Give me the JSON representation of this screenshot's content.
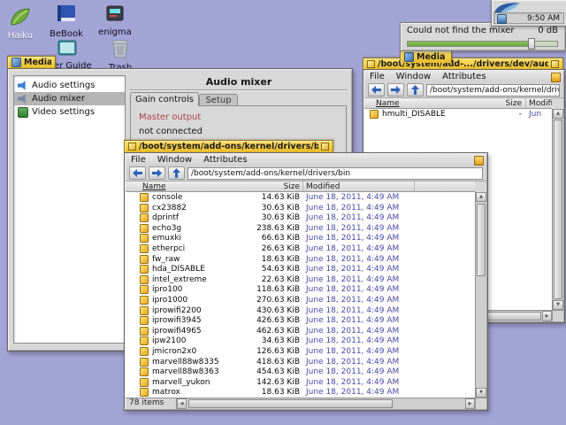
{
  "colors": {
    "desktop": "#a2a4d6",
    "window-bg": "#d8d8d8",
    "tab-top": "#fce06a",
    "tab-bottom": "#e9bb28",
    "tab-border": "#8f7215",
    "selection": "#b4b4b4",
    "date-text": "#4a4aa8",
    "master-output": "#aa4444",
    "nav-arrow": "#2e62b8",
    "slider-green": "#6da443"
  },
  "desktop": {
    "icons": [
      {
        "label": "Haiku",
        "icon": "haiku-leaf"
      },
      {
        "label": "BeBook",
        "icon": "bebook"
      },
      {
        "label": "enigma",
        "icon": "enigma"
      },
      {
        "label": "User Guide",
        "icon": "user-guide"
      },
      {
        "label": "Trash",
        "icon": "trash"
      }
    ]
  },
  "deskbar": {
    "time": "9:50 AM"
  },
  "notification": {
    "message": "Could not find the mixer",
    "value": "0 dB",
    "slider_percent": 82
  },
  "media_mini_tab": {
    "title": "Media"
  },
  "media_window": {
    "tab_title": "Media",
    "panel_title": "Audio mixer",
    "list": [
      {
        "label": "Audio settings",
        "icon": "audio-settings"
      },
      {
        "label": "Audio mixer",
        "icon": "audio-mixer",
        "selected": true
      },
      {
        "label": "Video settings",
        "icon": "video-settings"
      }
    ],
    "tabs": [
      {
        "label": "Gain controls",
        "active": true
      },
      {
        "label": "Setup",
        "active": false
      }
    ],
    "content": {
      "line1": "Master output",
      "line2": "not connected"
    }
  },
  "audio_window": {
    "tab_title": "/boot/system/add-.../drivers/dev/audio",
    "menus": [
      "File",
      "Window",
      "Attributes"
    ],
    "path": "/boot/system/add-ons/kernel/drivers/dev/audio",
    "columns": [
      "Name",
      "Size",
      "Modified"
    ],
    "rows": [
      {
        "name": "hmulti_DISABLE",
        "size": "-",
        "modified": "Jun"
      }
    ]
  },
  "bin_window": {
    "tab_title": "/boot/system/add-ons/kernel/drivers/bin",
    "menus": [
      "File",
      "Window",
      "Attributes"
    ],
    "path": "/boot/system/add-ons/kernel/drivers/bin",
    "columns": [
      "Name",
      "Size",
      "Modified"
    ],
    "status": "78 items",
    "rows": [
      {
        "name": "console",
        "size": "14.63 KiB",
        "modified": "June 18, 2011, 4:49 AM"
      },
      {
        "name": "cx23882",
        "size": "30.63 KiB",
        "modified": "June 18, 2011, 4:49 AM"
      },
      {
        "name": "dprintf",
        "size": "30.63 KiB",
        "modified": "June 18, 2011, 4:49 AM"
      },
      {
        "name": "echo3g",
        "size": "238.63 KiB",
        "modified": "June 18, 2011, 4:49 AM"
      },
      {
        "name": "emuxki",
        "size": "66.63 KiB",
        "modified": "June 18, 2011, 4:49 AM"
      },
      {
        "name": "etherpci",
        "size": "26.63 KiB",
        "modified": "June 18, 2011, 4:49 AM"
      },
      {
        "name": "fw_raw",
        "size": "18.63 KiB",
        "modified": "June 18, 2011, 4:49 AM"
      },
      {
        "name": "hda_DISABLE",
        "size": "54.63 KiB",
        "modified": "June 18, 2011, 4:49 AM"
      },
      {
        "name": "intel_extreme",
        "size": "22.63 KiB",
        "modified": "June 18, 2011, 4:49 AM"
      },
      {
        "name": "ipro100",
        "size": "118.63 KiB",
        "modified": "June 18, 2011, 4:49 AM"
      },
      {
        "name": "ipro1000",
        "size": "270.63 KiB",
        "modified": "June 18, 2011, 4:49 AM"
      },
      {
        "name": "iprowifi2200",
        "size": "430.63 KiB",
        "modified": "June 18, 2011, 4:49 AM"
      },
      {
        "name": "iprowifi3945",
        "size": "426.63 KiB",
        "modified": "June 18, 2011, 4:49 AM"
      },
      {
        "name": "iprowifi4965",
        "size": "462.63 KiB",
        "modified": "June 18, 2011, 4:49 AM"
      },
      {
        "name": "ipw2100",
        "size": "34.63 KiB",
        "modified": "June 18, 2011, 4:49 AM"
      },
      {
        "name": "jmicron2x0",
        "size": "126.63 KiB",
        "modified": "June 18, 2011, 4:49 AM"
      },
      {
        "name": "marvell88w8335",
        "size": "418.63 KiB",
        "modified": "June 18, 2011, 4:49 AM"
      },
      {
        "name": "marvell88w8363",
        "size": "454.63 KiB",
        "modified": "June 18, 2011, 4:49 AM"
      },
      {
        "name": "marvell_yukon",
        "size": "142.63 KiB",
        "modified": "June 18, 2011, 4:49 AM"
      },
      {
        "name": "matrox",
        "size": "18.63 KiB",
        "modified": "June 18, 2011, 4:49 AM"
      }
    ]
  }
}
